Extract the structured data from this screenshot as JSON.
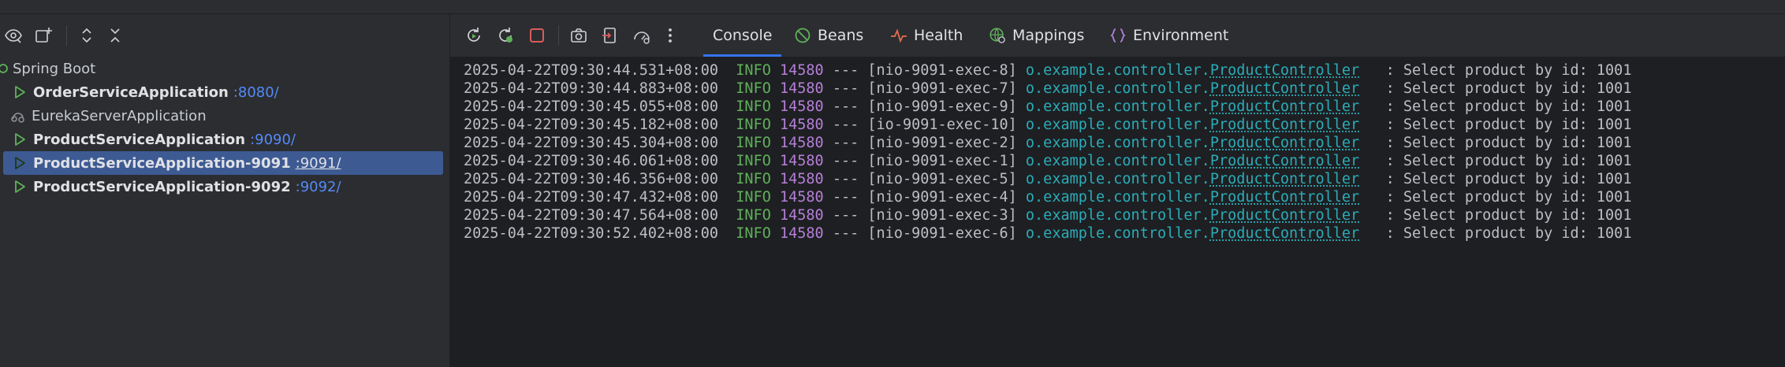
{
  "colors": {
    "background": "#2b2d30",
    "console_background": "#1e1f22",
    "selection": "#3d5a93",
    "port_link": "#548af7",
    "run_green": "#5fb05a",
    "stop_red": "#db5c5c",
    "log_info": "#5fb05a",
    "log_pid": "#b57fd8",
    "log_logger": "#2aacb8",
    "log_text": "#bcbec4",
    "tab_active_underline": "#3574f0"
  },
  "left_toolbar": {
    "icons": [
      "eye-icon",
      "add-service-icon",
      "expand-all-icon",
      "collapse-all-icon"
    ]
  },
  "services_tree": {
    "group": {
      "label": "Spring Boot",
      "icon": "spring-leaf-icon"
    },
    "items": [
      {
        "name": "OrderServiceApplication",
        "port": ":8080/",
        "state": "run-icon"
      },
      {
        "name": "EurekaServerApplication",
        "port": "",
        "state": "not-started-icon"
      },
      {
        "name": "ProductServiceApplication",
        "port": ":9090/",
        "state": "run-icon"
      },
      {
        "name": "ProductServiceApplication-9091",
        "port": ":9091/",
        "state": "run-icon",
        "selected": true
      },
      {
        "name": "ProductServiceApplication-9092",
        "port": ":9092/",
        "state": "run-icon"
      }
    ]
  },
  "console_toolbar": {
    "icons": [
      "rerun-icon",
      "restart-icon",
      "stop-icon",
      "camera-icon",
      "exit-icon",
      "gauge-icon",
      "more-icon"
    ]
  },
  "tabs": [
    {
      "label": "Console",
      "icon": "",
      "active": true
    },
    {
      "label": "Beans",
      "icon": "beans-icon"
    },
    {
      "label": "Health",
      "icon": "health-icon"
    },
    {
      "label": "Mappings",
      "icon": "mappings-icon"
    },
    {
      "label": "Environment",
      "icon": "environment-icon"
    }
  ],
  "console": {
    "lines": [
      {
        "timestamp": "2025-04-22T09:30:44.531+08:00",
        "level": "INFO",
        "pid": "14580",
        "sep": "---",
        "thread": "[nio-9091-exec-8]",
        "pkg": "o.example.controller.",
        "cls": "ProductController",
        "message": ": Select product by id: 1001"
      },
      {
        "timestamp": "2025-04-22T09:30:44.883+08:00",
        "level": "INFO",
        "pid": "14580",
        "sep": "---",
        "thread": "[nio-9091-exec-7]",
        "pkg": "o.example.controller.",
        "cls": "ProductController",
        "message": ": Select product by id: 1001"
      },
      {
        "timestamp": "2025-04-22T09:30:45.055+08:00",
        "level": "INFO",
        "pid": "14580",
        "sep": "---",
        "thread": "[nio-9091-exec-9]",
        "pkg": "o.example.controller.",
        "cls": "ProductController",
        "message": ": Select product by id: 1001"
      },
      {
        "timestamp": "2025-04-22T09:30:45.182+08:00",
        "level": "INFO",
        "pid": "14580",
        "sep": "---",
        "thread": "[io-9091-exec-10]",
        "pkg": "o.example.controller.",
        "cls": "ProductController",
        "message": ": Select product by id: 1001"
      },
      {
        "timestamp": "2025-04-22T09:30:45.304+08:00",
        "level": "INFO",
        "pid": "14580",
        "sep": "---",
        "thread": "[nio-9091-exec-2]",
        "pkg": "o.example.controller.",
        "cls": "ProductController",
        "message": ": Select product by id: 1001"
      },
      {
        "timestamp": "2025-04-22T09:30:46.061+08:00",
        "level": "INFO",
        "pid": "14580",
        "sep": "---",
        "thread": "[nio-9091-exec-1]",
        "pkg": "o.example.controller.",
        "cls": "ProductController",
        "message": ": Select product by id: 1001"
      },
      {
        "timestamp": "2025-04-22T09:30:46.356+08:00",
        "level": "INFO",
        "pid": "14580",
        "sep": "---",
        "thread": "[nio-9091-exec-5]",
        "pkg": "o.example.controller.",
        "cls": "ProductController",
        "message": ": Select product by id: 1001"
      },
      {
        "timestamp": "2025-04-22T09:30:47.432+08:00",
        "level": "INFO",
        "pid": "14580",
        "sep": "---",
        "thread": "[nio-9091-exec-4]",
        "pkg": "o.example.controller.",
        "cls": "ProductController",
        "message": ": Select product by id: 1001"
      },
      {
        "timestamp": "2025-04-22T09:30:47.564+08:00",
        "level": "INFO",
        "pid": "14580",
        "sep": "---",
        "thread": "[nio-9091-exec-3]",
        "pkg": "o.example.controller.",
        "cls": "ProductController",
        "message": ": Select product by id: 1001"
      },
      {
        "timestamp": "2025-04-22T09:30:52.402+08:00",
        "level": "INFO",
        "pid": "14580",
        "sep": "---",
        "thread": "[nio-9091-exec-6]",
        "pkg": "o.example.controller.",
        "cls": "ProductController",
        "message": ": Select product by id: 1001"
      }
    ]
  }
}
